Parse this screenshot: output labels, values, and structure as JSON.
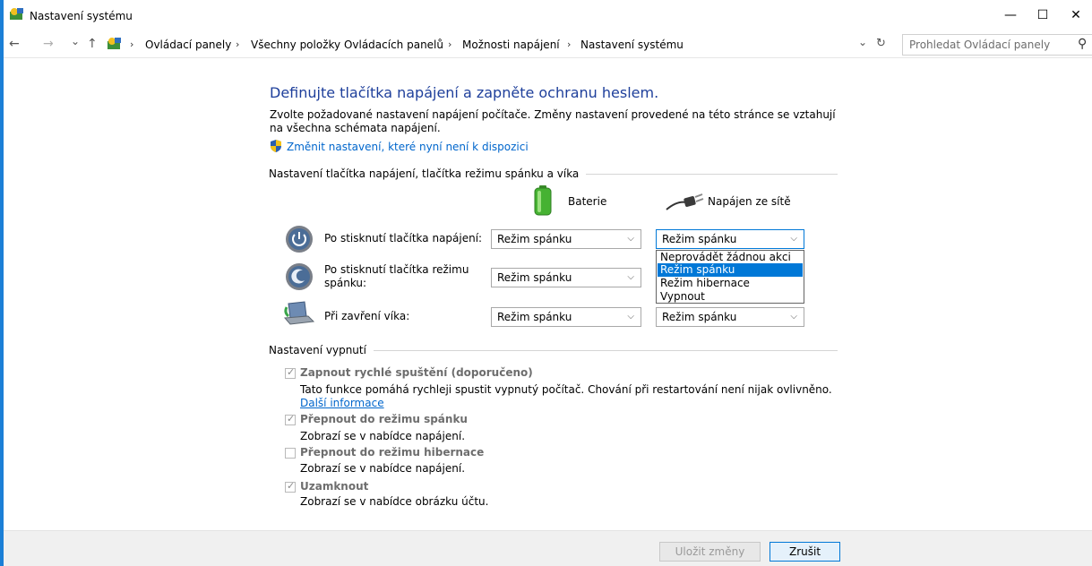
{
  "window": {
    "title": "Nastavení systému",
    "minimize": "—",
    "maximize": "☐",
    "close": "✕"
  },
  "nav": {
    "back": "←",
    "forward": "→",
    "recent": "⌄",
    "up": "↑",
    "breadcrumbs": [
      "Ovládací panely",
      "Všechny položky Ovládacích panelů",
      "Možnosti napájení",
      "Nastavení systému"
    ],
    "sep": "›",
    "history_dropdown": "⌄",
    "refresh": "↻",
    "search_placeholder": "Prohledat Ovládací panely",
    "search_icon": "⚲"
  },
  "main": {
    "heading": "Definujte tlačítka napájení a zapněte ochranu heslem.",
    "intro": "Zvolte požadované nastavení napájení počítače. Změny nastavení provedené na této stránce se vztahují na všechna schémata napájení.",
    "change_link": "Změnit nastavení, které nyní není k dispozici",
    "buttons_section_title": "Nastavení tlačítka napájení, tlačítka režimu spánku a víka",
    "col_battery": "Baterie",
    "col_ac": "Napájen ze sítě",
    "rows": [
      {
        "label": "Po stisknutí tlačítka napájení:",
        "battery": "Režim spánku",
        "ac": "Režim spánku"
      },
      {
        "label": "Po stisknutí tlačítka režimu spánku:",
        "battery": "Režim spánku",
        "ac": "Režim spánku"
      },
      {
        "label": "Při zavření víka:",
        "battery": "Režim spánku",
        "ac": "Režim spánku"
      }
    ],
    "dropdown_options": [
      "Neprovádět žádnou akci",
      "Režim spánku",
      "Režim hibernace",
      "Vypnout"
    ],
    "dropdown_selected": "Režim spánku",
    "shutdown_section_title": "Nastavení vypnutí",
    "shutdown_items": [
      {
        "label": "Zapnout rychlé spuštění (doporučeno)",
        "checked": true,
        "desc": "Tato funkce pomáhá rychleji spustit vypnutý počítač. Chování při restartování není nijak ovlivněno.",
        "link": "Další informace"
      },
      {
        "label": "Přepnout do režimu spánku",
        "checked": true,
        "desc": "Zobrazí se v nabídce napájení."
      },
      {
        "label": "Přepnout do režimu hibernace",
        "checked": false,
        "desc": "Zobrazí se v nabídce napájení."
      },
      {
        "label": "Uzamknout",
        "checked": true,
        "desc": "Zobrazí se v nabídce obrázku účtu."
      }
    ],
    "check_mark": "✓",
    "chevron": "⌵"
  },
  "footer": {
    "save": "Uložit změny",
    "cancel": "Zrušit"
  },
  "colors": {
    "heading": "#1e3f9b",
    "link": "#0066cc",
    "accent": "#0078d7",
    "frame": "#1b7fd6"
  }
}
